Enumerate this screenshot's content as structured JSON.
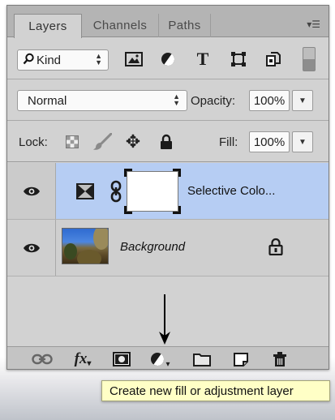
{
  "panel": {
    "tabs": [
      {
        "label": "Layers",
        "active": true
      },
      {
        "label": "Channels",
        "active": false
      },
      {
        "label": "Paths",
        "active": false
      }
    ],
    "menu_icon": "panel-menu-icon"
  },
  "filter": {
    "kind_label": "Kind",
    "icons": [
      "pixel-layer-filter-icon",
      "adjustment-layer-filter-icon",
      "type-layer-filter-icon",
      "shape-layer-filter-icon",
      "smart-object-filter-icon"
    ],
    "type_glyph": "T"
  },
  "blend": {
    "mode": "Normal",
    "opacity_label": "Opacity:",
    "opacity_value": "100%"
  },
  "lock": {
    "label": "Lock:",
    "fill_label": "Fill:",
    "fill_value": "100%"
  },
  "layers": [
    {
      "name": "Selective Colo...",
      "type": "adjustment",
      "selected": true,
      "visible": true
    },
    {
      "name": "Background",
      "type": "image",
      "selected": false,
      "visible": true,
      "locked": true
    }
  ],
  "toolbar": {
    "fx_label": "fx",
    "buttons": [
      "link-layers-icon",
      "layer-style-fx-icon",
      "add-mask-icon",
      "adjustment-layer-icon",
      "new-group-icon",
      "new-layer-icon",
      "trash-icon"
    ]
  },
  "tooltip": {
    "text": "Create new fill or adjustment layer"
  },
  "colors": {
    "selected_layer": "#b6cdf3",
    "panel_bg": "#d2d2d2",
    "tooltip_bg": "#ffffc6"
  }
}
